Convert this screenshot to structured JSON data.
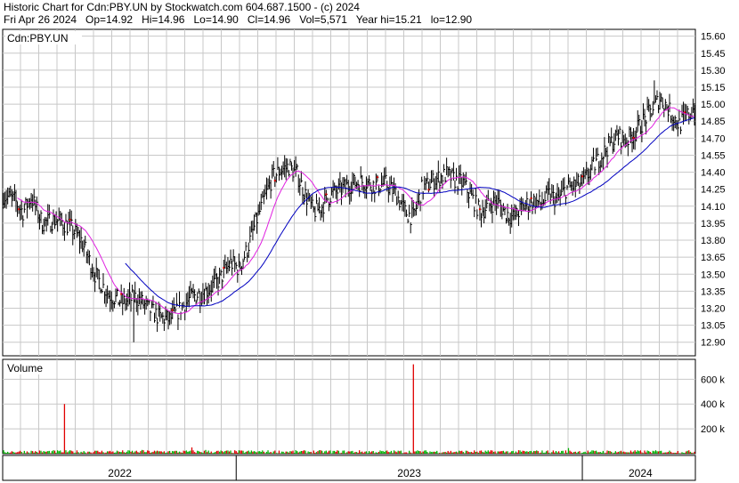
{
  "header": {
    "line1": "Historic Chart for Cdn:PBY.UN by Stockwatch.com 604.687.1500 - (c) 2024",
    "line2": "Fri Apr 26 2024   Op=14.92   Hi=14.96   Lo=14.90   Cl=14.96   Vol=5,571   Year hi=15.21   lo=12.90"
  },
  "colors": {
    "background": "#ffffff",
    "grid": "#c8c8c8",
    "frame": "#000000",
    "price_bar": "#000000",
    "red_marker": "#e00000",
    "ma_short": "#e020e0",
    "ma_long": "#0000c0",
    "volume_up": "#00b000",
    "volume_down": "#e00000"
  },
  "chart_data": [
    {
      "type": "ohlc",
      "title": "Cdn:PBY.UN",
      "yaxis_side": "right",
      "ylim": [
        12.78,
        15.66
      ],
      "yticks": [
        "15.60",
        "15.45",
        "15.30",
        "15.15",
        "15.00",
        "14.85",
        "14.70",
        "14.55",
        "14.40",
        "14.25",
        "14.10",
        "13.95",
        "13.80",
        "13.65",
        "13.50",
        "13.35",
        "13.20",
        "13.05",
        "12.90"
      ],
      "grid": true,
      "price_anchors": [
        [
          0,
          14.2
        ],
        [
          8,
          14.15
        ],
        [
          14,
          14.05
        ],
        [
          20,
          14.18
        ],
        [
          28,
          13.95
        ],
        [
          38,
          13.98
        ],
        [
          48,
          13.92
        ],
        [
          56,
          13.8
        ],
        [
          66,
          13.5
        ],
        [
          76,
          13.32
        ],
        [
          86,
          13.25
        ],
        [
          96,
          13.3
        ],
        [
          104,
          13.2
        ],
        [
          112,
          13.12
        ],
        [
          120,
          13.1
        ],
        [
          128,
          13.2
        ],
        [
          136,
          13.3
        ],
        [
          146,
          13.35
        ],
        [
          156,
          13.45
        ],
        [
          164,
          13.6
        ],
        [
          170,
          13.55
        ],
        [
          176,
          13.72
        ],
        [
          182,
          13.95
        ],
        [
          188,
          14.15
        ],
        [
          194,
          14.35
        ],
        [
          200,
          14.42
        ],
        [
          206,
          14.45
        ],
        [
          212,
          14.38
        ],
        [
          218,
          14.2
        ],
        [
          224,
          14.05
        ],
        [
          230,
          14.1
        ],
        [
          236,
          14.2
        ],
        [
          244,
          14.25
        ],
        [
          252,
          14.3
        ],
        [
          260,
          14.32
        ],
        [
          268,
          14.28
        ],
        [
          276,
          14.3
        ],
        [
          284,
          14.2
        ],
        [
          290,
          14.05
        ],
        [
          296,
          14.0
        ],
        [
          302,
          14.25
        ],
        [
          308,
          14.3
        ],
        [
          314,
          14.35
        ],
        [
          320,
          14.38
        ],
        [
          326,
          14.33
        ],
        [
          332,
          14.3
        ],
        [
          338,
          14.18
        ],
        [
          344,
          14.05
        ],
        [
          350,
          14.1
        ],
        [
          356,
          14.15
        ],
        [
          362,
          14.05
        ],
        [
          368,
          14.0
        ],
        [
          376,
          14.1
        ],
        [
          382,
          14.15
        ],
        [
          388,
          14.12
        ],
        [
          394,
          14.2
        ],
        [
          400,
          14.15
        ],
        [
          406,
          14.25
        ],
        [
          412,
          14.28
        ],
        [
          418,
          14.3
        ],
        [
          426,
          14.45
        ],
        [
          432,
          14.55
        ],
        [
          438,
          14.65
        ],
        [
          444,
          14.72
        ],
        [
          450,
          14.68
        ],
        [
          456,
          14.75
        ],
        [
          462,
          14.85
        ],
        [
          468,
          14.95
        ],
        [
          474,
          15.05
        ],
        [
          478,
          15.0
        ],
        [
          482,
          14.92
        ],
        [
          488,
          14.82
        ],
        [
          494,
          14.9
        ],
        [
          498,
          14.96
        ]
      ],
      "bars": 500,
      "series": [
        {
          "name": "",
          "kind": "short-ma"
        },
        {
          "name": "",
          "kind": "long-ma"
        }
      ]
    },
    {
      "type": "bar",
      "title": "Volume",
      "yticks": [
        "600 k",
        "400 k",
        "200 k"
      ],
      "ylim": [
        0,
        760000
      ],
      "spikes": [
        [
          44,
          400000
        ],
        [
          296,
          720000
        ],
        [
          136,
          50000
        ],
        [
          146,
          30000
        ],
        [
          100,
          30000
        ],
        [
          408,
          45000
        ],
        [
          120,
          22000
        ]
      ],
      "base_range": [
        3000,
        28000
      ]
    }
  ],
  "xaxis": {
    "labels": [
      "2022",
      "2023",
      "2024"
    ],
    "dividers": [
      168,
      418
    ],
    "label_centers": [
      84,
      293,
      460
    ]
  }
}
